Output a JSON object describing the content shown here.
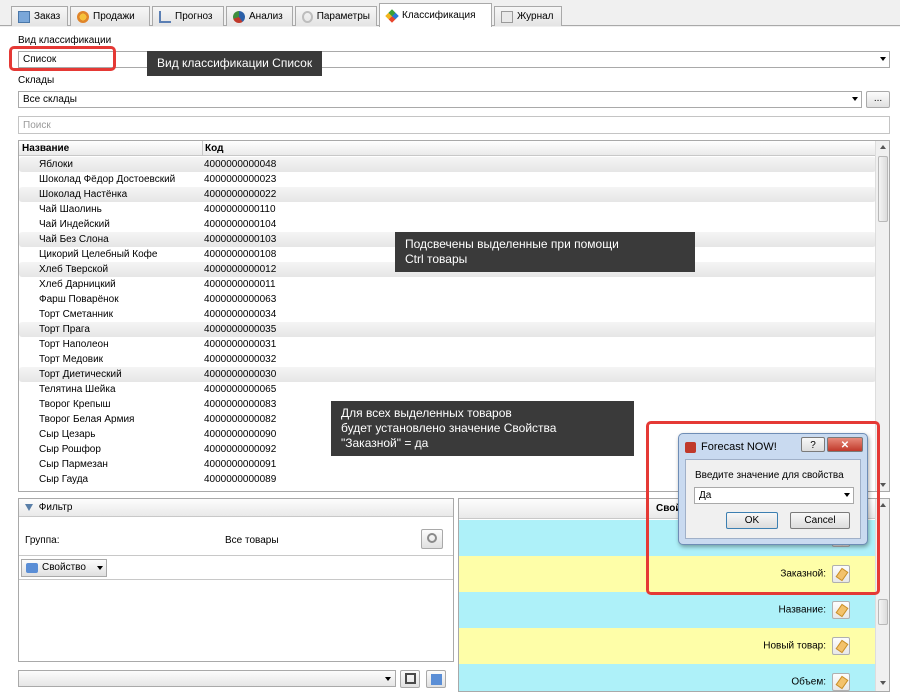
{
  "tabs": [
    {
      "label": "Заказ",
      "icon": "order-icon"
    },
    {
      "label": "Продажи",
      "icon": "sales-icon"
    },
    {
      "label": "Прогноз",
      "icon": "forecast-icon"
    },
    {
      "label": "Анализ",
      "icon": "analysis-icon"
    },
    {
      "label": "Параметры",
      "icon": "parameters-icon"
    },
    {
      "label": "Классификация",
      "icon": "classification-icon",
      "active": true
    },
    {
      "label": "Журнал",
      "icon": "journal-icon"
    }
  ],
  "classification": {
    "type_label": "Вид классификации",
    "type_value": "Список",
    "warehouses_label": "Склады",
    "warehouses_value": "Все склады",
    "dots_button": "...",
    "search_placeholder": "Поиск"
  },
  "grid": {
    "columns": [
      "Название",
      "Код"
    ],
    "rows": [
      {
        "name": "Яблоки",
        "code": "4000000000048",
        "selected": true
      },
      {
        "name": "Шоколад Фёдор Достоевский",
        "code": "4000000000023",
        "selected": false
      },
      {
        "name": "Шоколад Настёнка",
        "code": "4000000000022",
        "selected": true
      },
      {
        "name": "Чай Шаолинь",
        "code": "4000000000110",
        "selected": false
      },
      {
        "name": "Чай Индейский",
        "code": "4000000000104",
        "selected": false
      },
      {
        "name": "Чай Без Слона",
        "code": "4000000000103",
        "selected": true
      },
      {
        "name": "Цикорий Целебный Кофе",
        "code": "4000000000108",
        "selected": false
      },
      {
        "name": "Хлеб Тверской",
        "code": "4000000000012",
        "selected": true
      },
      {
        "name": "Хлеб Дарницкий",
        "code": "4000000000011",
        "selected": false
      },
      {
        "name": "Фарш Поварёнок",
        "code": "4000000000063",
        "selected": false
      },
      {
        "name": "Торт Сметанник",
        "code": "4000000000034",
        "selected": false
      },
      {
        "name": "Торт Прага",
        "code": "4000000000035",
        "selected": true
      },
      {
        "name": "Торт Наполеон",
        "code": "4000000000031",
        "selected": false
      },
      {
        "name": "Торт Медовик",
        "code": "4000000000032",
        "selected": false
      },
      {
        "name": "Торт Диетический",
        "code": "4000000000030",
        "selected": true
      },
      {
        "name": "Телятина Шейка",
        "code": "4000000000065",
        "selected": false
      },
      {
        "name": "Творог Крепыш",
        "code": "4000000000083",
        "selected": false
      },
      {
        "name": "Творог Белая Армия",
        "code": "4000000000082",
        "selected": false
      },
      {
        "name": "Сыр Цезарь",
        "code": "4000000000090",
        "selected": false
      },
      {
        "name": "Сыр Рошфор",
        "code": "4000000000092",
        "selected": false
      },
      {
        "name": "Сыр Пармезан",
        "code": "4000000000091",
        "selected": false
      },
      {
        "name": "Сыр Гауда",
        "code": "4000000000089",
        "selected": false
      }
    ]
  },
  "filter": {
    "title": "Фильтр",
    "group_label": "Группа:",
    "group_value": "Все товары",
    "property_button": "Свойство"
  },
  "properties": {
    "title": "Свойст",
    "rows": [
      {
        "label": "",
        "color": "#aef1f9"
      },
      {
        "label": "Заказной:",
        "color": "#fefea8"
      },
      {
        "label": "Название:",
        "color": "#aef1f9"
      },
      {
        "label": "Новый товар:",
        "color": "#fefea8"
      },
      {
        "label": "Объем:",
        "color": "#aef1f9"
      }
    ]
  },
  "dialog": {
    "title": "Forecast NOW!",
    "help": "?",
    "prompt": "Введите значение для свойства",
    "value": "Да",
    "ok": "OK",
    "cancel": "Cancel"
  },
  "annotations": {
    "classification_type": "Вид классификации Список",
    "highlighted": [
      "Подсвечены выделенные при помощи",
      "Ctrl товары"
    ],
    "all_selected": [
      "Для всех выделенных товаров",
      "будет установлено значение Свойства",
      "\"Заказной\" = да"
    ]
  },
  "colors": {
    "accent_red": "#e53935",
    "callout_bg": "#3a3a3a",
    "cyan_row": "#aef1f9",
    "yellow_row": "#fefea8"
  }
}
